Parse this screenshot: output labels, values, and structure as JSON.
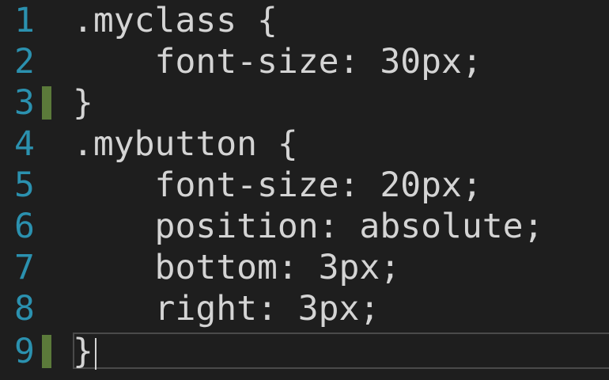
{
  "editor": {
    "lines": [
      {
        "number": "1",
        "text": ".myclass {",
        "modified": false
      },
      {
        "number": "2",
        "text": "    font-size: 30px;",
        "modified": false
      },
      {
        "number": "3",
        "text": "}",
        "modified": true
      },
      {
        "number": "4",
        "text": ".mybutton {",
        "modified": false
      },
      {
        "number": "5",
        "text": "    font-size: 20px;",
        "modified": false
      },
      {
        "number": "6",
        "text": "    position: absolute;",
        "modified": false
      },
      {
        "number": "7",
        "text": "    bottom: 3px;",
        "modified": false
      },
      {
        "number": "8",
        "text": "    right: 3px;",
        "modified": false
      },
      {
        "number": "9",
        "text": "}",
        "modified": true
      }
    ],
    "colors": {
      "background": "#1e1e1e",
      "line_number": "#2b91af",
      "text": "#d4d4d4",
      "change_marker": "#5b7a3a",
      "current_line_border": "#4a4a4a"
    }
  }
}
